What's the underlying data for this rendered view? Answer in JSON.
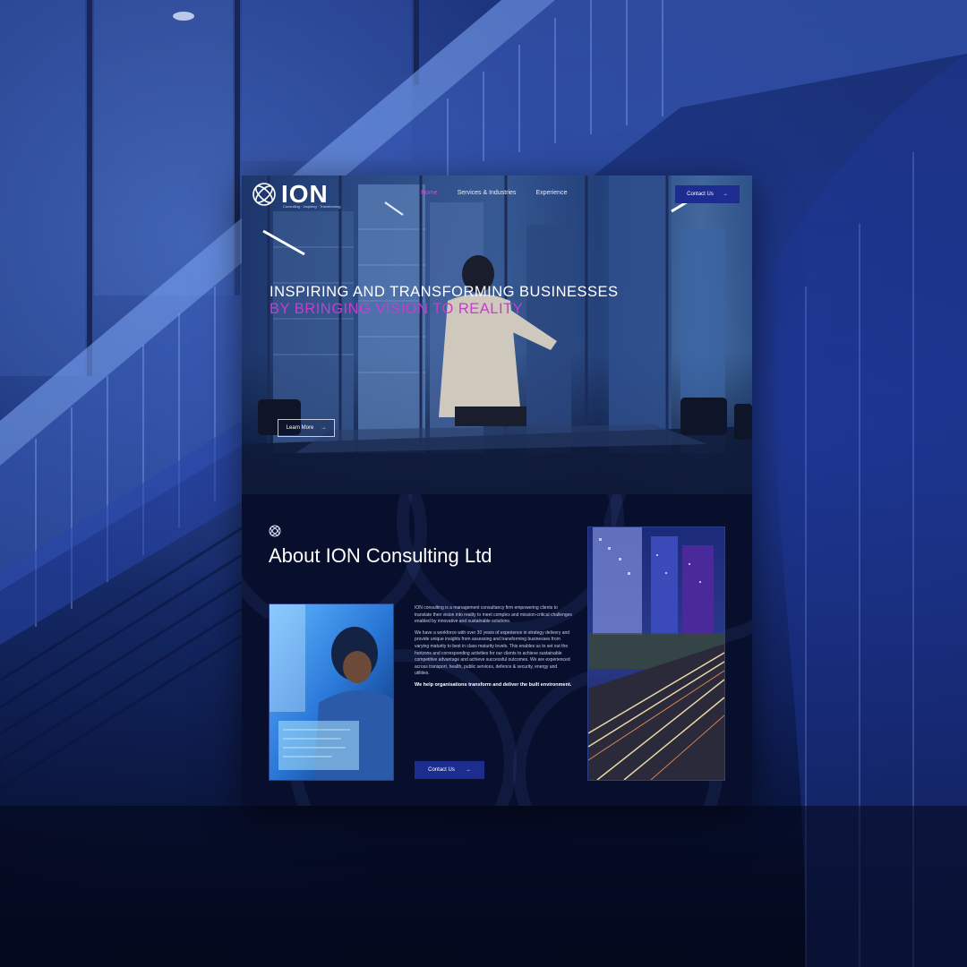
{
  "site": {
    "logo": {
      "text": "ION",
      "tagline": "Consulting · Inspiring · Transforming"
    },
    "nav": {
      "links": [
        {
          "label": "Home",
          "active": true
        },
        {
          "label": "Services & Industries",
          "active": false
        },
        {
          "label": "Experience",
          "active": false
        }
      ],
      "cta_label": "Contact Us",
      "cta_arrow": "→"
    },
    "hero": {
      "headline": "INSPIRING AND TRANSFORMING BUSINESSES",
      "highlight": "BY BRINGING VISION TO REALITY",
      "button_label": "Learn More",
      "button_arrow": "→"
    },
    "about": {
      "title": "About ION Consulting Ltd",
      "paragraphs": [
        "ION consulting is a management consultancy firm empowering clients to translate their vision into reality to meet complex and mission-critical challenges enabled by innovative and sustainable solutions.",
        "We have a workforce with over 30 years of experience in strategy delivery and provide unique insights from assessing and transforming businesses from varying maturity to best in class maturity levels. This enables us to set out the horizons and corresponding activities for our clients to achieve sustainable competitive advantage and achieve successful outcomes. We are experienced across transport, health, public services, defence & security, energy and utilities."
      ],
      "closing": "We help organisations transform and deliver the built environment.",
      "button_label": "Contact Us",
      "button_arrow": "→"
    }
  },
  "colors": {
    "accent": "#c83cd0",
    "button": "#1c2d8f",
    "background": "#07102e"
  }
}
